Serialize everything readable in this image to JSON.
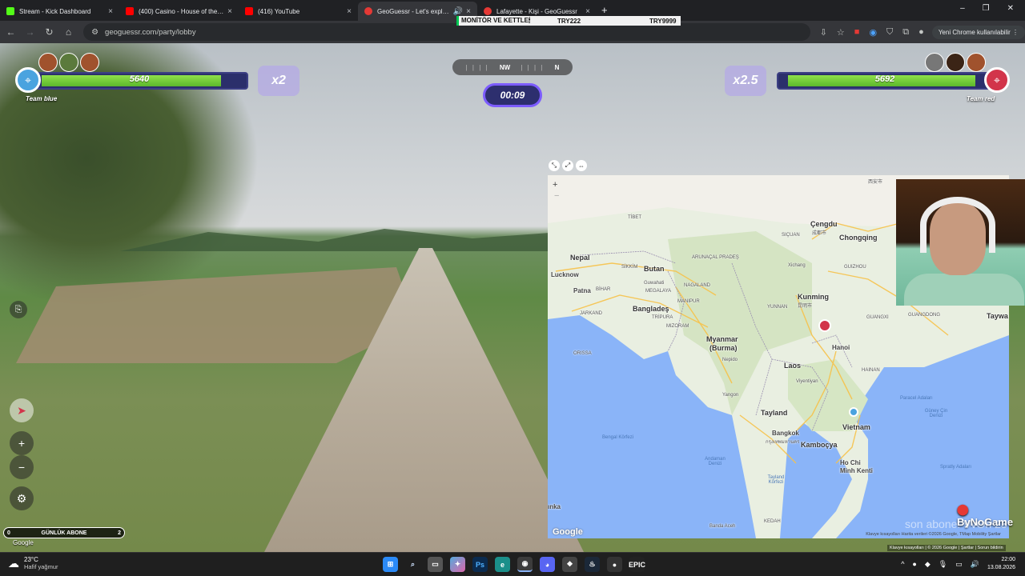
{
  "browser": {
    "tabs": [
      {
        "title": "Stream - Kick Dashboard",
        "fav_color": "#53fc18",
        "active": false
      },
      {
        "title": "(400) Casino - House of the Ri",
        "fav_color": "#ff0000",
        "active": false
      },
      {
        "title": "(416) YouTube",
        "fav_color": "#ff0000",
        "active": false
      },
      {
        "title": "GeoGuessr - Let's explore t",
        "fav_color": "#e53935",
        "active": true
      },
      {
        "title": "Lafayette - Kişi - GeoGuessr",
        "fav_color": "#e53935",
        "active": false
      }
    ],
    "close_glyph": "×",
    "new_tab": "+",
    "url": "geoguessr.com/party/lobby",
    "update_button": "Yeni Chrome kullanılabilir",
    "window_controls": [
      "–",
      "❐",
      "✕"
    ]
  },
  "ticker": {
    "product": "MONİTÖR VE KETTLE🕯",
    "price1": "TRY222",
    "price2": "TRY9999"
  },
  "game": {
    "team_blue": {
      "score": "5640",
      "label": "Team blue",
      "multiplier": "x2",
      "color": "#4aa3df",
      "fill": 0.91
    },
    "team_red": {
      "score": "5692",
      "label": "Team red",
      "multiplier": "x2.5",
      "color": "#d2344a",
      "fill": 0.96
    },
    "compass": {
      "heading": "NW",
      "next": "N"
    },
    "timer": "00:09",
    "subs_left": "0",
    "subs_label": "GÜNLÜK ABONE",
    "subs_right": "2",
    "google_text": "Google"
  },
  "map": {
    "labels": {
      "nepal": "Nepal",
      "butan": "Butan",
      "tibet": "TİBET",
      "lucknow": "Lucknow",
      "patna": "Patna",
      "bangladesh": "Bangladeş",
      "myanmar": "Myanmar",
      "burma": "(Burma)",
      "laos": "Laos",
      "tayland": "Tayland",
      "vietnam": "Vietnam",
      "kambocya": "Kamboçya",
      "hochi": "Ho Chi",
      "minh": "Minh Kenti",
      "kunming": "Kunming",
      "chengdu": "Çengdu",
      "chongqing": "Chongqing",
      "hanoi": "Hanoi",
      "bangkok": "Bangkok",
      "yangon": "Yangon",
      "vientiane": "Viyentiyan",
      "yunnan": "YUNNAN",
      "sichuan": "SIÇUAN",
      "guizhou": "GUIZHOU",
      "guangdong": "GUANGDONG",
      "hainan": "HAINAN",
      "orissa": "ORISSA",
      "jharkand": "JARKAND",
      "manipur": "MANIPUR",
      "nagaland": "NAGALAND",
      "meghalaya": "MEGALAYA",
      "mizoram": "MIZORAM",
      "tripura": "TRİPURA",
      "arunachal": "ARUNAÇAL PRADEŞ",
      "sikkim": "SİKKİM",
      "bihar": "BİHAR",
      "bengal": "Bengal Körfezi",
      "andaman": "Andaman Denizi",
      "siam": "Tayland Körfezi",
      "scs": "Güney Çin Denizi",
      "paracel": "Paracel Adaları",
      "spratly": "Spratly Adaları",
      "taiwan": "Taywa",
      "lanka": "ınka",
      "banda": "Banda Aceh",
      "kedah": "KEDAH",
      "guangxi": "GUANGXI",
      "xichang": "Xichang",
      "guwahati": "Guwahati",
      "nepido": "Nepido",
      "bangkok_th": "กรุงเทพมหานคร",
      "kunming_cn": "昆明市",
      "chengdu_cn": "成都市",
      "xian": "西安市"
    },
    "zoom_in": "+",
    "zoom_out": "−",
    "google": "Google",
    "footer": "Klavye kısayolları   Harita verileri ©2026 Google, TMap Mobility   Şartlar",
    "tools": [
      "⤡",
      "⤢",
      "⇔"
    ]
  },
  "stream_overlay": {
    "brand": "ByNoGame",
    "watermark": "son abone: VvOh 23",
    "key_footer": "Klavye kısayolları  |  © 2026 Google  |  Şartlar  |  Sorun bildirin"
  },
  "taskbar": {
    "temp": "23°C",
    "weather": "Hafif yağmur",
    "time": "22:00",
    "date": "13.08.2026"
  }
}
